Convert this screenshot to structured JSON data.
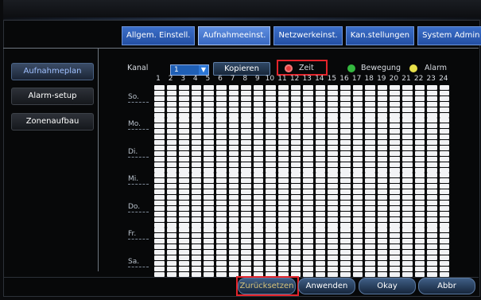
{
  "tabs": [
    {
      "label": "Allgem. Einstell."
    },
    {
      "label": "Aufnahmeeinst."
    },
    {
      "label": "Netzwerkeinst."
    },
    {
      "label": "Kan.stellungen"
    },
    {
      "label": "System Admin"
    }
  ],
  "sidebar": {
    "items": [
      {
        "label": "Aufnahmeplan"
      },
      {
        "label": "Alarm-setup"
      },
      {
        "label": "Zonenaufbau"
      }
    ]
  },
  "controls": {
    "kanal_label": "Kanal",
    "kanal_value": "1",
    "copy_label": "Kopieren"
  },
  "legend": [
    {
      "label": "Zeit",
      "color": "#e63a3a"
    },
    {
      "label": "Bewegung",
      "color": "#34b83f"
    },
    {
      "label": "Alarm",
      "color": "#e8e04a"
    }
  ],
  "schedule": {
    "hours": [
      "1",
      "2",
      "3",
      "4",
      "5",
      "6",
      "7",
      "8",
      "9",
      "10",
      "11",
      "12",
      "13",
      "14",
      "15",
      "16",
      "17",
      "18",
      "19",
      "20",
      "21",
      "22",
      "23",
      "24"
    ],
    "days": [
      "So.",
      "Mo.",
      "Di.",
      "Mi.",
      "Do.",
      "Fr.",
      "Sa."
    ]
  },
  "footer": {
    "reset_label": "Zurücksetzen",
    "apply_label": "Anwenden",
    "ok_label": "Okay",
    "cancel_label": "Abbr"
  },
  "colors": {
    "accent_blue": "#234fa3",
    "highlight_red": "#e3242b",
    "cell_white": "#f2f3f5"
  }
}
